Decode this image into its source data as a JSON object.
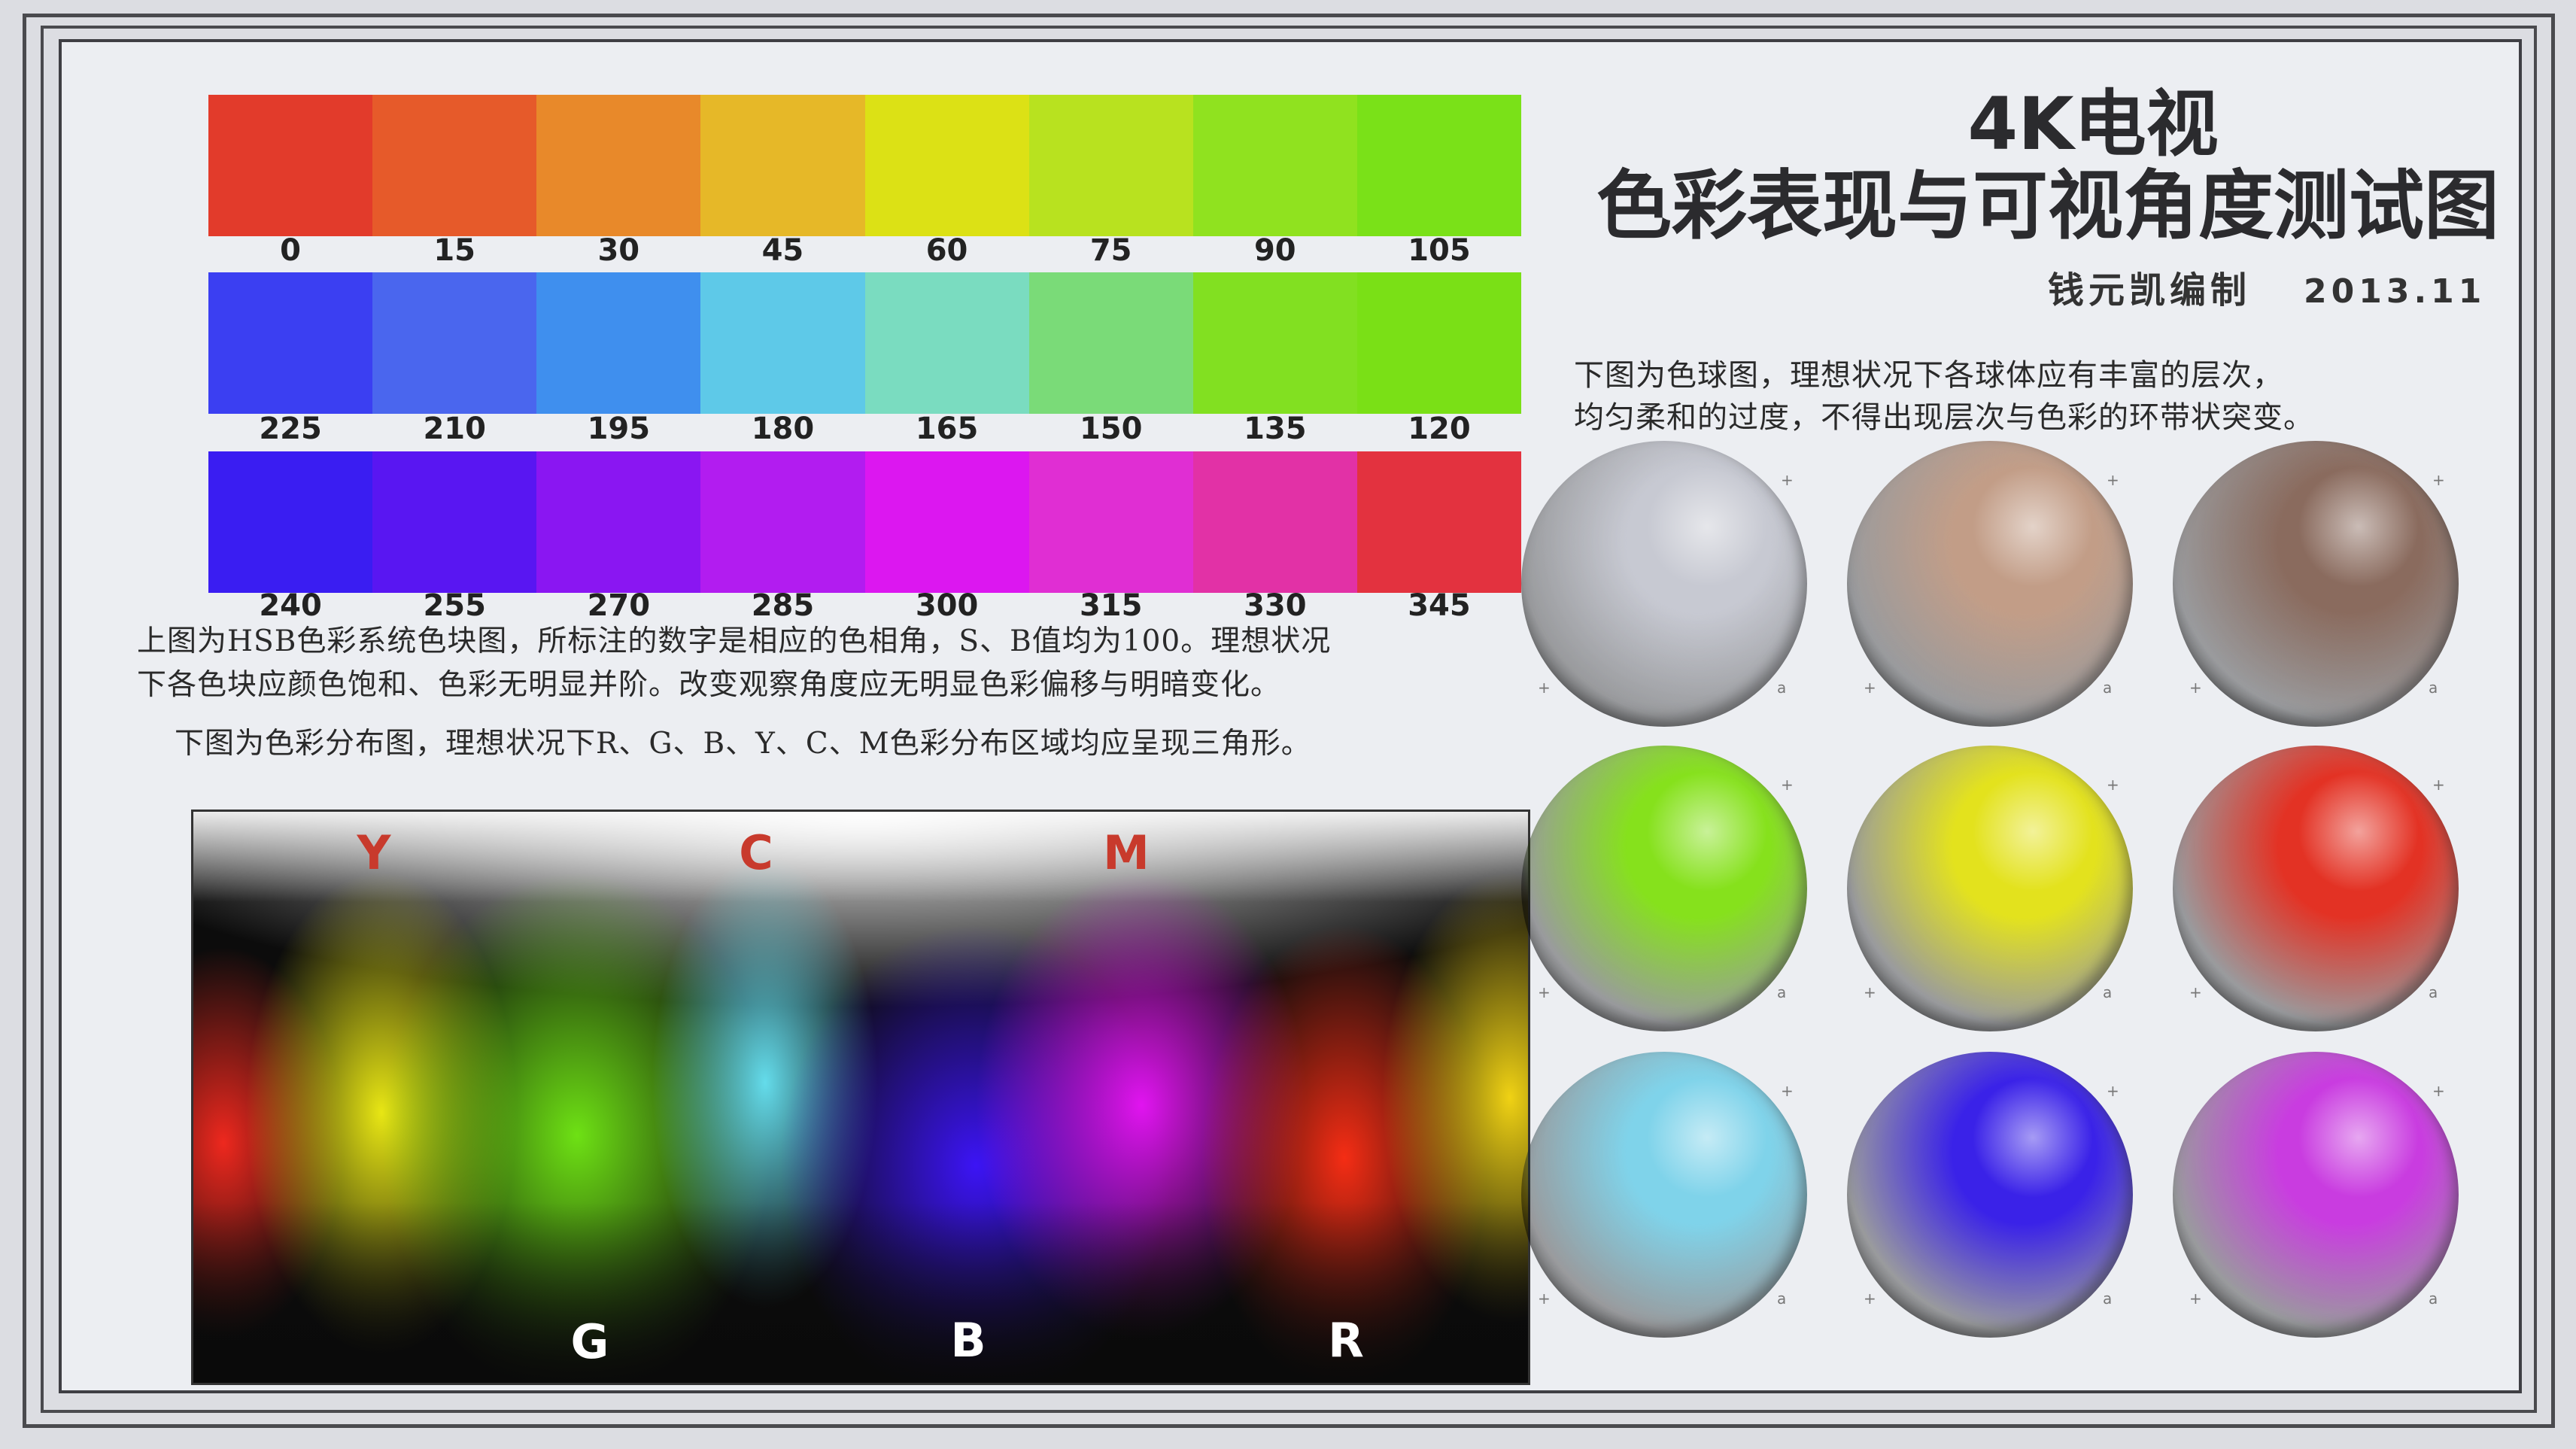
{
  "title": {
    "line1": "4K电视",
    "line2": "色彩表现与可视角度测试图",
    "author": "钱元凯编制",
    "date": "2013.11"
  },
  "hue_strips": [
    {
      "labels": [
        "0",
        "15",
        "30",
        "45",
        "60",
        "75",
        "90",
        "105"
      ],
      "colors": [
        "#e23b2b",
        "#e65a2a",
        "#e8892a",
        "#e6b828",
        "#dce115",
        "#b8e21f",
        "#90e21f",
        "#7ae118"
      ]
    },
    {
      "labels": [
        "225",
        "210",
        "195",
        "180",
        "165",
        "150",
        "135",
        "120"
      ],
      "colors": [
        "#3b3ff2",
        "#4a66ee",
        "#3f8fee",
        "#5ec9e8",
        "#7adcc0",
        "#7adb78",
        "#82e021",
        "#7ae016"
      ]
    },
    {
      "labels": [
        "240",
        "255",
        "270",
        "285",
        "300",
        "315",
        "330",
        "345"
      ],
      "colors": [
        "#3a1df2",
        "#5916f2",
        "#8a16f2",
        "#b21cf0",
        "#dc17f0",
        "#e02ed3",
        "#e231a6",
        "#e3323f"
      ]
    }
  ],
  "hsb_description": {
    "line1": "上图为HSB色彩系统色块图，所标注的数字是相应的色相角，S、B值均为100。理想状况",
    "line2": "下各色块应颜色饱和、色彩无明显并阶。改变观察角度应无明显色彩偏移与明暗变化。"
  },
  "distribution_description": "下图为色彩分布图，理想状况下R、G、B、Y、C、M色彩分布区域均应呈现三角形。",
  "distribution": {
    "top_labels": [
      "Y",
      "C",
      "M"
    ],
    "bottom_labels": [
      "G",
      "B",
      "R"
    ],
    "top_label_color": "#c83a2c",
    "bottom_label_color": "#ffffff"
  },
  "sphere_description": {
    "line1": "下图为色球图，理想状况下各球体应有丰富的层次，",
    "line2": "均匀柔和的过度，不得出现层次与色彩的环带状突变。"
  },
  "spheres": [
    {
      "name": "gray",
      "color": "#c7c9d2"
    },
    {
      "name": "tan",
      "color": "#c29d87"
    },
    {
      "name": "brown",
      "color": "#8a6b5e"
    },
    {
      "name": "green",
      "color": "#86e11c"
    },
    {
      "name": "yellow",
      "color": "#e3e21d"
    },
    {
      "name": "red",
      "color": "#e33224"
    },
    {
      "name": "cyan",
      "color": "#7fd3ea"
    },
    {
      "name": "blue",
      "color": "#3a22e8"
    },
    {
      "name": "magenta",
      "color": "#c93ce0"
    }
  ],
  "sphere_marks": {
    "plus": "+",
    "corner": "a"
  }
}
